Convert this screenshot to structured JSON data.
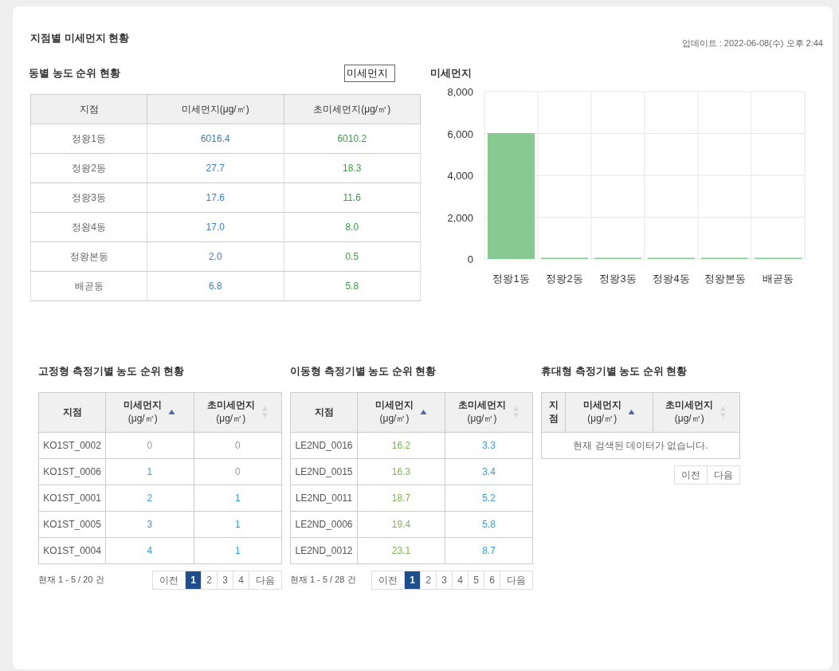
{
  "title": "지점별 미세먼지 현황",
  "updated": "업데이트 : 2022-06-08(수) 오후 2:44",
  "district": {
    "title": "동별 농도 순위 현황",
    "select": {
      "value": "미세먼지"
    },
    "columns": [
      {
        "label": "지점"
      },
      {
        "label": "미세먼지(μg/㎥)",
        "color": "#3a7fc0"
      },
      {
        "label": "초미세먼지(μg/㎥)",
        "color": "#3f9a4a"
      }
    ],
    "rows": [
      [
        "정왕1동",
        "6016.4",
        "6010.2"
      ],
      [
        "정왕2동",
        "27.7",
        "18.3"
      ],
      [
        "정왕3동",
        "17.6",
        "11.6"
      ],
      [
        "정왕4동",
        "17.0",
        "8.0"
      ],
      [
        "정왕본동",
        "2.0",
        "0.5"
      ],
      [
        "배곧동",
        "6.8",
        "5.8"
      ]
    ]
  },
  "chart": {
    "chart_data": {
      "type": "bar",
      "title": "미세먼지",
      "grid": true,
      "categories": [
        "정왕1동",
        "정왕2동",
        "정왕3동",
        "정왕4동",
        "정왕본동",
        "배곧동"
      ],
      "series": [
        {
          "color": "#88c891",
          "values": [
            6020,
            30,
            20,
            20,
            0,
            10
          ]
        }
      ],
      "ylim": [
        0,
        8000
      ],
      "yticks": [
        {
          "value": 0,
          "label": "0"
        },
        {
          "value": 2000,
          "label": "2,000"
        },
        {
          "value": 4000,
          "label": "4,000"
        },
        {
          "value": 6000,
          "label": "6,000"
        },
        {
          "value": 8000,
          "label": "8,000"
        }
      ]
    }
  },
  "panels": [
    {
      "title": "고정형 측정기별 농도 순위 현황",
      "columns": [
        {
          "label": "지점"
        },
        {
          "label": "미세먼지",
          "unit": "(μg/㎥)",
          "sorted": true
        },
        {
          "label": "초미세먼지",
          "unit": "(μg/㎥)",
          "sorted": false
        }
      ],
      "rows": [
        {
          "site": "KO1ST_0002",
          "values": [
            {
              "text": "0",
              "color": "#999999"
            },
            {
              "text": "0",
              "color": "#999999"
            }
          ]
        },
        {
          "site": "KO1ST_0006",
          "values": [
            {
              "text": "1",
              "color": "#3a9ad0"
            },
            {
              "text": "0",
              "color": "#999999"
            }
          ]
        },
        {
          "site": "KO1ST_0001",
          "values": [
            {
              "text": "2",
              "color": "#3a9ad0"
            },
            {
              "text": "1",
              "color": "#3a9ad0"
            }
          ]
        },
        {
          "site": "KO1ST_0005",
          "values": [
            {
              "text": "3",
              "color": "#3a9ad0"
            },
            {
              "text": "1",
              "color": "#3a9ad0"
            }
          ]
        },
        {
          "site": "KO1ST_0004",
          "values": [
            {
              "text": "4",
              "color": "#3a9ad0"
            },
            {
              "text": "1",
              "color": "#3a9ad0"
            }
          ]
        }
      ],
      "count": "현재 1 - 5 / 20 건",
      "prev": "이전",
      "next": "다음",
      "pages": [
        {
          "label": "1",
          "selected": true
        },
        {
          "label": "2",
          "selected": false
        },
        {
          "label": "3",
          "selected": false
        },
        {
          "label": "4",
          "selected": false
        }
      ]
    },
    {
      "title": "이동형 측정기별 농도 순위 현황",
      "columns": [
        {
          "label": "지점"
        },
        {
          "label": "미세먼지",
          "unit": "(μg/㎥)",
          "sorted": true
        },
        {
          "label": "초미세먼지",
          "unit": "(μg/㎥)",
          "sorted": false
        }
      ],
      "rows": [
        {
          "site": "LE2ND_0016",
          "values": [
            {
              "text": "16.2",
              "color": "#7ab648"
            },
            {
              "text": "3.3",
              "color": "#3a9ad0"
            }
          ]
        },
        {
          "site": "LE2ND_0015",
          "values": [
            {
              "text": "16.3",
              "color": "#7ab648"
            },
            {
              "text": "3.4",
              "color": "#3a9ad0"
            }
          ]
        },
        {
          "site": "LE2ND_0011",
          "values": [
            {
              "text": "18.7",
              "color": "#7ab648"
            },
            {
              "text": "5.2",
              "color": "#3a9ad0"
            }
          ]
        },
        {
          "site": "LE2ND_0006",
          "values": [
            {
              "text": "19.4",
              "color": "#7ab648"
            },
            {
              "text": "5.8",
              "color": "#3a9ad0"
            }
          ]
        },
        {
          "site": "LE2ND_0012",
          "values": [
            {
              "text": "23.1",
              "color": "#7ab648"
            },
            {
              "text": "8.7",
              "color": "#3a9ad0"
            }
          ]
        }
      ],
      "count": "현재 1 - 5 / 28 건",
      "prev": "이전",
      "next": "다음",
      "pages": [
        {
          "label": "1",
          "selected": true
        },
        {
          "label": "2",
          "selected": false
        },
        {
          "label": "3",
          "selected": false
        },
        {
          "label": "4",
          "selected": false
        },
        {
          "label": "5",
          "selected": false
        },
        {
          "label": "6",
          "selected": false
        }
      ]
    },
    {
      "title": "휴대형 측정기별 농도 순위 현황",
      "columns": [
        {
          "label": "지점"
        },
        {
          "label": "미세먼지",
          "unit": "(μg/㎥)",
          "sorted": true
        },
        {
          "label": "초미세먼지",
          "unit": "(μg/㎥)",
          "sorted": false
        }
      ],
      "empty": "현재 검색된 데이터가 없습니다.",
      "prev": "이전",
      "next": "다음"
    }
  ]
}
